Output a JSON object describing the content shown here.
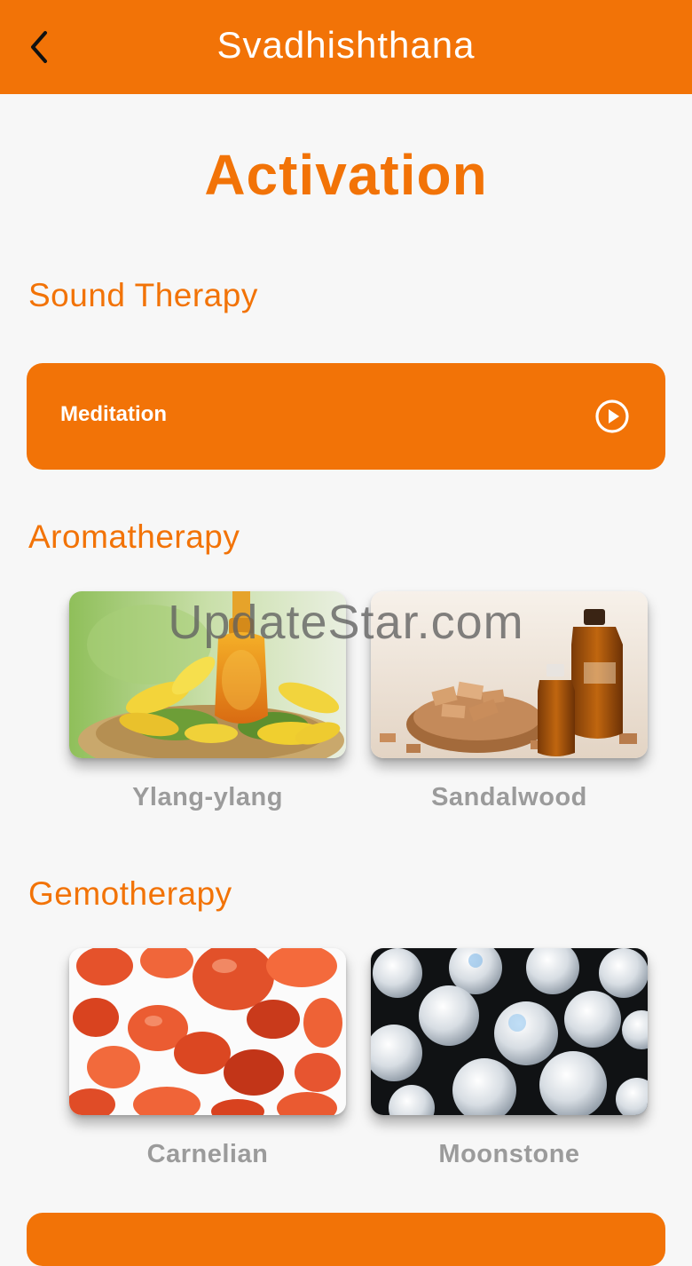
{
  "header": {
    "title": "Svadhishthana",
    "back_icon": "chevron-left-icon"
  },
  "page": {
    "title": "Activation"
  },
  "sound_therapy": {
    "heading": "Sound Therapy",
    "items": [
      {
        "label": "Meditation",
        "icon": "play-circle-icon"
      }
    ]
  },
  "aromatherapy": {
    "heading": "Aromatherapy",
    "items": [
      {
        "label": "Ylang-ylang"
      },
      {
        "label": "Sandalwood"
      }
    ]
  },
  "gemotherapy": {
    "heading": "Gemotherapy",
    "items": [
      {
        "label": "Carnelian"
      },
      {
        "label": "Moonstone"
      }
    ]
  },
  "watermark": "UpdateStar.com",
  "colors": {
    "accent": "#f27307",
    "background": "#f7f7f7",
    "caption": "#9b9b9b"
  }
}
